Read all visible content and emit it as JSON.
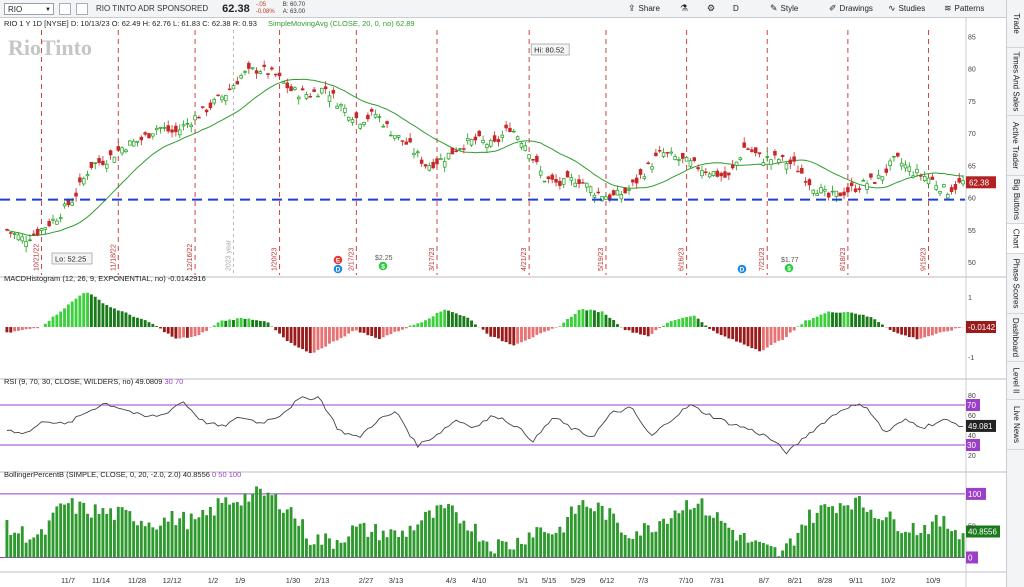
{
  "toolbar": {
    "symbol": "RIO",
    "company": "RIO TINTO ADR SPONSORED",
    "last": "62.38",
    "change": "-.05",
    "change_pct": "-0.08%",
    "bid": "B: 60.70",
    "ask": "A: 63.00",
    "share": "Share",
    "period": "D",
    "style": "Style",
    "drawings": "Drawings",
    "studies": "Studies",
    "patterns": "Patterns"
  },
  "sidebar": [
    "Trade",
    "Times And Sales",
    "Active Trader",
    "Big Buttons",
    "Chart",
    "Phase Scores",
    "Dashboard",
    "Level II",
    "Live News"
  ],
  "chart_data": [
    {
      "type": "candlestick",
      "title": "RIO 1 Y 1D [NYSE]",
      "ohlc_header": {
        "date": "D: 10/13/23",
        "open": "O: 62.49",
        "high": "H: 62.76",
        "low": "L: 61.83",
        "close": "C: 62.38",
        "range": "R: 0.93"
      },
      "study_label": "SimpleMovingAvg (CLOSE, 20, 0, no)",
      "study_value": "62.89",
      "logo_text": "RioTinto",
      "ylim": [
        48,
        86
      ],
      "yticks": [
        50,
        55,
        60,
        65,
        70,
        75,
        80,
        85
      ],
      "hi_label": "Hi: 80.52",
      "lo_label": "Lo: 52.25",
      "support_line": 59.7,
      "last_price_tag": "62.38",
      "period_markers": [
        "10/21/22",
        "11/18/22",
        "12/16/22",
        "1/20/23",
        "2/17/23",
        "3/17/23",
        "4/21/23",
        "5/19/23",
        "6/16/23",
        "7/21/23",
        "8/18/23",
        "9/15/23"
      ],
      "year_marker": "2023 year",
      "event_icons": [
        {
          "date": "2/17/23",
          "label": "E"
        },
        {
          "date": "2/17/23",
          "label": "D"
        },
        {
          "date": "3/3/23",
          "label": "$",
          "value": "$2.25"
        },
        {
          "date": "7/21/23",
          "label": "D"
        },
        {
          "date": "8/4/23",
          "label": "$",
          "value": "$1.77"
        }
      ],
      "close_anchors": [
        [
          "10/17",
          55
        ],
        [
          "10/21",
          53.5
        ],
        [
          "10/28",
          55
        ],
        [
          "11/4",
          57
        ],
        [
          "11/7",
          60
        ],
        [
          "11/10",
          65
        ],
        [
          "11/18",
          66
        ],
        [
          "11/28",
          68
        ],
        [
          "12/6",
          69
        ],
        [
          "12/12",
          71
        ],
        [
          "12/20",
          70
        ],
        [
          "12/28",
          72
        ],
        [
          "1/3",
          74
        ],
        [
          "1/9",
          76
        ],
        [
          "1/17",
          79
        ],
        [
          "1/20",
          80
        ],
        [
          "1/24",
          79
        ],
        [
          "1/30",
          76.5
        ],
        [
          "2/6",
          76
        ],
        [
          "2/13",
          77
        ],
        [
          "2/17",
          74
        ],
        [
          "2/24",
          72
        ],
        [
          "3/1",
          73
        ],
        [
          "3/6",
          70
        ],
        [
          "3/13",
          68
        ],
        [
          "3/17",
          65
        ],
        [
          "3/24",
          66
        ],
        [
          "3/31",
          68
        ],
        [
          "4/6",
          69
        ],
        [
          "4/12",
          68
        ],
        [
          "4/18",
          71
        ],
        [
          "4/21",
          68
        ],
        [
          "4/28",
          63
        ],
        [
          "5/5",
          62
        ],
        [
          "5/12",
          63
        ],
        [
          "5/19",
          61
        ],
        [
          "5/25",
          60
        ],
        [
          "5/31",
          61
        ],
        [
          "6/6",
          64
        ],
        [
          "6/12",
          67
        ],
        [
          "6/16",
          66
        ],
        [
          "6/23",
          65
        ],
        [
          "6/30",
          64
        ],
        [
          "7/7",
          63
        ],
        [
          "7/14",
          68
        ],
        [
          "7/21",
          66
        ],
        [
          "7/28",
          66
        ],
        [
          "8/4",
          65
        ],
        [
          "8/11",
          62
        ],
        [
          "8/18",
          60
        ],
        [
          "8/25",
          61
        ],
        [
          "9/1",
          62
        ],
        [
          "9/8",
          63
        ],
        [
          "9/15",
          66
        ],
        [
          "9/22",
          64
        ],
        [
          "9/29",
          63
        ],
        [
          "10/5",
          61
        ],
        [
          "10/13",
          62.38
        ]
      ]
    },
    {
      "type": "bar",
      "title": "MACDHistogram (12, 26, 9, EXPONENTIAL, no)",
      "value_label": "-0.0142916",
      "last_tag": "-0.0142",
      "ylim": [
        -1.5,
        1.5
      ],
      "yticks": [
        1,
        0,
        -1
      ],
      "anchors": [
        [
          0,
          -0.2
        ],
        [
          6,
          0
        ],
        [
          10,
          0.6
        ],
        [
          14,
          1.2
        ],
        [
          18,
          0.7
        ],
        [
          22,
          0.4
        ],
        [
          26,
          0.1
        ],
        [
          30,
          -0.4
        ],
        [
          34,
          -0.3
        ],
        [
          38,
          0.2
        ],
        [
          42,
          0.3
        ],
        [
          46,
          0.2
        ],
        [
          50,
          -0.5
        ],
        [
          54,
          -0.9
        ],
        [
          58,
          -0.5
        ],
        [
          62,
          -0.1
        ],
        [
          66,
          -0.4
        ],
        [
          70,
          -0.1
        ],
        [
          74,
          0.2
        ],
        [
          78,
          0.6
        ],
        [
          82,
          0.3
        ],
        [
          86,
          -0.3
        ],
        [
          90,
          -0.6
        ],
        [
          94,
          -0.3
        ],
        [
          98,
          0
        ],
        [
          102,
          0.6
        ],
        [
          106,
          0.5
        ],
        [
          110,
          -0.1
        ],
        [
          114,
          -0.3
        ],
        [
          118,
          0.2
        ],
        [
          122,
          0.4
        ],
        [
          126,
          -0.2
        ],
        [
          130,
          -0.5
        ],
        [
          134,
          -0.8
        ],
        [
          138,
          -0.4
        ],
        [
          142,
          0.2
        ],
        [
          146,
          0.5
        ],
        [
          150,
          0.5
        ],
        [
          154,
          0.3
        ],
        [
          158,
          -0.2
        ],
        [
          162,
          -0.4
        ],
        [
          166,
          -0.2
        ],
        [
          170,
          0
        ]
      ]
    },
    {
      "type": "line",
      "title": "RSI (9, 70, 30, CLOSE, WILDERS, no)",
      "value_label": "49.0809",
      "levels_label": [
        "30",
        "70"
      ],
      "last_tag": "49.081",
      "level_tags": [
        "70",
        "30"
      ],
      "ylim": [
        10,
        90
      ],
      "yticks": [
        80,
        60,
        40,
        20
      ],
      "overbought": 70,
      "oversold": 30,
      "anchors": [
        [
          0,
          45
        ],
        [
          4,
          42
        ],
        [
          8,
          55
        ],
        [
          12,
          50
        ],
        [
          16,
          62
        ],
        [
          20,
          72
        ],
        [
          24,
          66
        ],
        [
          28,
          58
        ],
        [
          32,
          60
        ],
        [
          36,
          74
        ],
        [
          40,
          54
        ],
        [
          44,
          48
        ],
        [
          48,
          58
        ],
        [
          52,
          52
        ],
        [
          56,
          60
        ],
        [
          60,
          76
        ],
        [
          64,
          78
        ],
        [
          68,
          45
        ],
        [
          72,
          37
        ],
        [
          76,
          55
        ],
        [
          80,
          63
        ],
        [
          84,
          29
        ],
        [
          88,
          40
        ],
        [
          92,
          55
        ],
        [
          96,
          48
        ],
        [
          100,
          60
        ],
        [
          104,
          50
        ],
        [
          108,
          34
        ],
        [
          112,
          58
        ],
        [
          116,
          46
        ],
        [
          120,
          38
        ],
        [
          124,
          62
        ],
        [
          128,
          67
        ],
        [
          132,
          38
        ],
        [
          136,
          55
        ],
        [
          140,
          70
        ],
        [
          144,
          60
        ],
        [
          148,
          52
        ],
        [
          152,
          46
        ],
        [
          156,
          38
        ],
        [
          160,
          22
        ],
        [
          164,
          40
        ],
        [
          168,
          55
        ],
        [
          172,
          68
        ],
        [
          176,
          70
        ],
        [
          180,
          42
        ],
        [
          184,
          55
        ],
        [
          188,
          48
        ],
        [
          192,
          55
        ],
        [
          196,
          49
        ]
      ]
    },
    {
      "type": "bar",
      "title": "BollingerPercentB (SIMPLE, CLOSE, 0, 20, -2.0, 2.0)",
      "value_label": "40.8556",
      "levels_label": [
        "0",
        "50",
        "100"
      ],
      "last_tag": "40.8556",
      "level_tags": [
        "100",
        "0"
      ],
      "ylim": [
        -15,
        125
      ],
      "yticks": [
        100,
        50,
        0
      ],
      "anchors": [
        [
          0,
          45
        ],
        [
          6,
          30
        ],
        [
          10,
          85
        ],
        [
          14,
          75
        ],
        [
          18,
          70
        ],
        [
          22,
          65
        ],
        [
          26,
          55
        ],
        [
          30,
          62
        ],
        [
          34,
          55
        ],
        [
          38,
          85
        ],
        [
          42,
          95
        ],
        [
          46,
          100
        ],
        [
          50,
          80
        ],
        [
          54,
          30
        ],
        [
          58,
          25
        ],
        [
          62,
          45
        ],
        [
          66,
          40
        ],
        [
          70,
          35
        ],
        [
          74,
          60
        ],
        [
          78,
          75
        ],
        [
          82,
          55
        ],
        [
          86,
          20
        ],
        [
          90,
          20
        ],
        [
          94,
          45
        ],
        [
          98,
          40
        ],
        [
          102,
          85
        ],
        [
          106,
          75
        ],
        [
          110,
          40
        ],
        [
          114,
          45
        ],
        [
          118,
          70
        ],
        [
          122,
          90
        ],
        [
          126,
          65
        ],
        [
          130,
          35
        ],
        [
          134,
          15
        ],
        [
          138,
          5
        ],
        [
          142,
          60
        ],
        [
          146,
          80
        ],
        [
          150,
          90
        ],
        [
          154,
          75
        ],
        [
          158,
          55
        ],
        [
          162,
          45
        ],
        [
          166,
          55
        ],
        [
          170,
          40
        ]
      ]
    }
  ],
  "x_axis": {
    "ticks": [
      "11/7",
      "11/14",
      "11/28",
      "12/12",
      "1/2",
      "1/9",
      "1/30",
      "2/13",
      "2/27",
      "3/13",
      "4/3",
      "4/10",
      "5/1",
      "5/15",
      "5/29",
      "6/12",
      "7/3",
      "7/10",
      "7/31",
      "8/7",
      "8/21",
      "8/28",
      "9/11",
      "10/2",
      "10/9"
    ]
  },
  "colors": {
    "up": "#1a9e1a",
    "down": "#c62828",
    "sma": "#2e9e2e",
    "support": "#1f3fd0",
    "period_line": "#d04444",
    "level": "#9c3fc8",
    "bbar": "#2e9a2e",
    "rsi": "#444444"
  }
}
